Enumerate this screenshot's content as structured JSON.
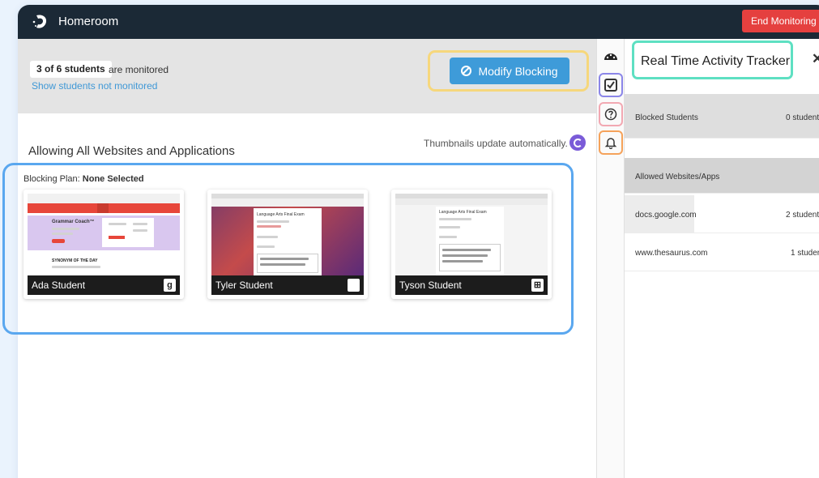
{
  "app": {
    "brand": "Homeroom",
    "end_monitoring_label": "End Monitoring"
  },
  "colors": {
    "topbar": "#1b2936",
    "end_button": "#e5403f",
    "accent": "#3e9bd9",
    "link": "#3f98d6"
  },
  "header": {
    "count_label": "3 of 6 students",
    "monitored_text": "are monitored",
    "show_link": "Show students not monitored",
    "modify_label": "Modify Blocking"
  },
  "content": {
    "allow_title": "Allowing All Websites and Applications",
    "thumb_note": "Thumbnails update automatically.",
    "plan_label": "Blocking Plan:",
    "plan_value": "None Selected"
  },
  "students": [
    {
      "name": "Ada Student",
      "os_icon": "google-icon",
      "os_glyph": "g"
    },
    {
      "name": "Tyler Student",
      "os_icon": "apple-icon",
      "os_glyph": ""
    },
    {
      "name": "Tyson Student",
      "os_icon": "windows-icon",
      "os_glyph": "⊞"
    }
  ],
  "thumbs": {
    "ada": {
      "heading": "SYNONYM OF THE DAY",
      "promo": "Grammar Coach™"
    },
    "doc": {
      "title": "Language Arts Final Exam",
      "quote": "\"He was very tall and strong, with a face as big as a ham—plain and pale, but intelligent and smiling.\""
    }
  },
  "sidebar": {
    "icons": [
      "dashboard-icon",
      "checkbox-icon",
      "help-icon",
      "bell-icon"
    ]
  },
  "tracker": {
    "title": "Real Time Activity Tracker",
    "close": "✕",
    "blocked_label": "Blocked Students",
    "blocked_count": "0 student",
    "allowed_header": "Allowed Websites/Apps",
    "sites": [
      {
        "url": "docs.google.com",
        "count": "2 student"
      },
      {
        "url": "www.thesaurus.com",
        "count": "1 studer"
      }
    ]
  }
}
